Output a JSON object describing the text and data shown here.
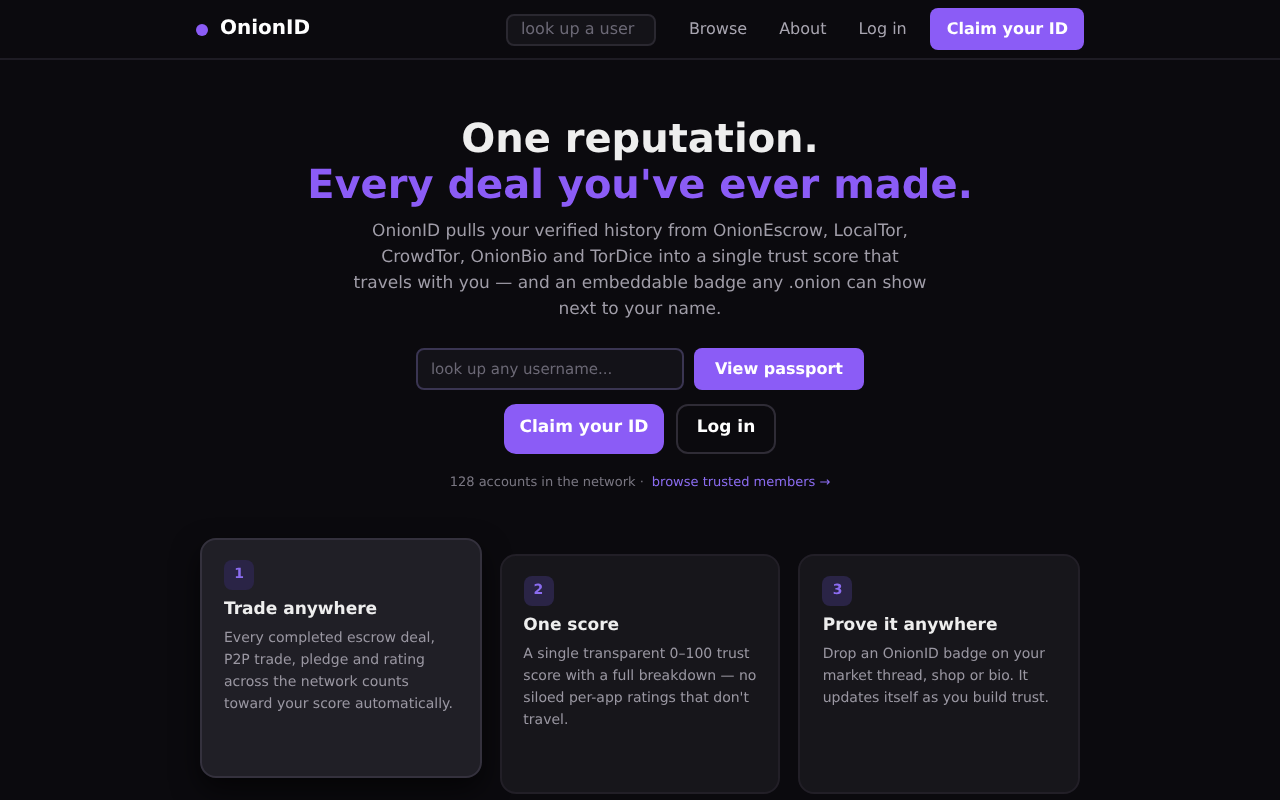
{
  "nav": {
    "brand": "OnionID",
    "search": {
      "placeholder": "look up a user"
    },
    "links": [
      "Browse",
      "About",
      "Log in"
    ],
    "cta": "Claim your ID"
  },
  "hero": {
    "title": "One reputation.",
    "subtitle": "Every deal you've ever made.",
    "description": "OnionID pulls your verified history from OnionEscrow, LocalTor, CrowdTor, OnionBio and TorDice into a single trust score that travels with you — and an embeddable badge any .onion can show next to your name.",
    "lookup": {
      "placeholder": "look up any username...",
      "button": "View passport"
    },
    "primary": "Claim your ID",
    "secondary": "Log in",
    "stats": "128 accounts in the network ·",
    "stats_link": "browse trusted members →"
  },
  "features": [
    {
      "number": "1",
      "title": "Trade anywhere",
      "text": "Every completed escrow deal, P2P trade, pledge and rating across the network counts toward your score automatically.",
      "raised": true
    },
    {
      "number": "2",
      "title": "One score",
      "text": "A single transparent 0–100 trust score with a full breakdown — no siloed per-app ratings that don't travel.",
      "raised": false
    },
    {
      "number": "3",
      "title": "Prove it anywhere",
      "text": "Drop an OnionID badge on your market thread, shop or bio. It updates itself as you build trust.",
      "raised": false
    }
  ]
}
